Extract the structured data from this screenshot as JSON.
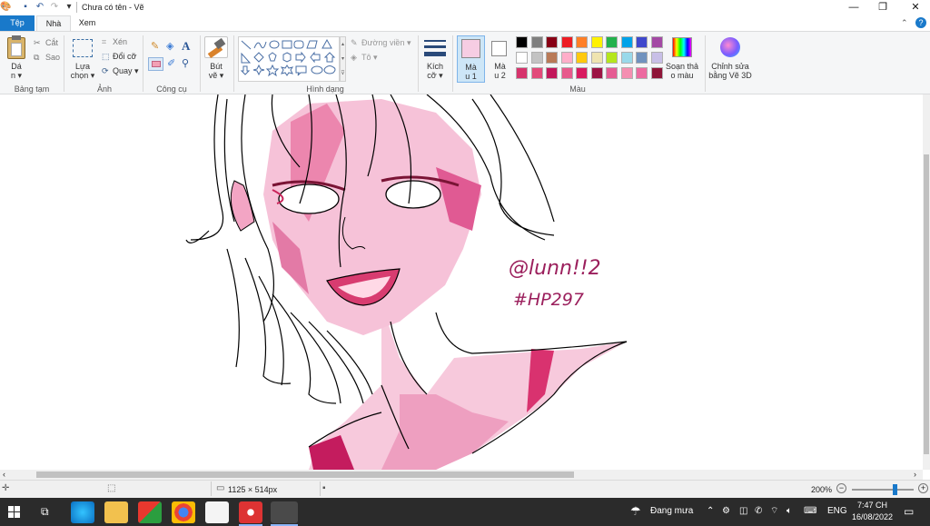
{
  "window": {
    "title": "Chưa có tên - Vẽ",
    "min": "—",
    "restore": "❐",
    "close": "✕",
    "collapse": "⌃",
    "help": "?"
  },
  "tabs": {
    "file": "Tệp",
    "home": "Nhà",
    "view": "Xem"
  },
  "ribbon": {
    "clipboard": {
      "paste_top": "Dá",
      "paste_bottom": "n ▾",
      "cut": "Cắt",
      "copy": "Sao",
      "group": "Bảng tạm"
    },
    "image": {
      "select_top": "Lựa",
      "select_bottom": "chọn ▾",
      "crop": "Xén",
      "resize": "Đổi cỡ",
      "rotate": "Quay ▾",
      "group": "Ảnh"
    },
    "tools": {
      "text_glyph": "A",
      "group": "Công cụ"
    },
    "brushes": {
      "label_top": "Bút",
      "label_bottom": "vẽ ▾"
    },
    "shapes": {
      "outline": "Đường viền ▾",
      "fill": "Tô ▾",
      "group": "Hình dạng"
    },
    "size": {
      "label_top": "Kích",
      "label_bottom": "cỡ ▾"
    },
    "color1": {
      "label_top": "Mà",
      "label_bottom": "u 1",
      "value": "#f6cde3"
    },
    "color2": {
      "label_top": "Mà",
      "label_bottom": "u 2",
      "value": "#ffffff"
    },
    "edit_colors": {
      "label_top": "Soạn thả",
      "label_bottom": "o màu"
    },
    "paint3d": {
      "label_top": "Chỉnh sửa",
      "label_bottom": "bằng Vẽ 3D"
    },
    "colors_group": "Màu",
    "palette": [
      "#000000",
      "#7f7f7f",
      "#880015",
      "#ed1c24",
      "#ff7f27",
      "#fff200",
      "#22b14c",
      "#00a2e8",
      "#3f48cc",
      "#a349a4",
      "#ffffff",
      "#c3c3c3",
      "#b97a57",
      "#ffaec9",
      "#ffc90e",
      "#efe4b0",
      "#b5e61d",
      "#99d9ea",
      "#7092be",
      "#c8bfe7",
      "#d6336c",
      "#e24a7a",
      "#c2185b",
      "#e75a8c",
      "#d81b60",
      "#9c1444",
      "#e55c93",
      "#f48fb1",
      "#ec6aa0",
      "#8e1538"
    ]
  },
  "canvas": {
    "signature_line1": "@lunn!!2",
    "signature_line2": "#HP297"
  },
  "status": {
    "dimensions": "1125 × 514px",
    "zoom": "200%",
    "zoom_level": 0.72
  },
  "taskbar": {
    "weather": "Đang mưa",
    "lang": "ENG",
    "time": "7:47 CH",
    "date": "16/08/2022"
  }
}
